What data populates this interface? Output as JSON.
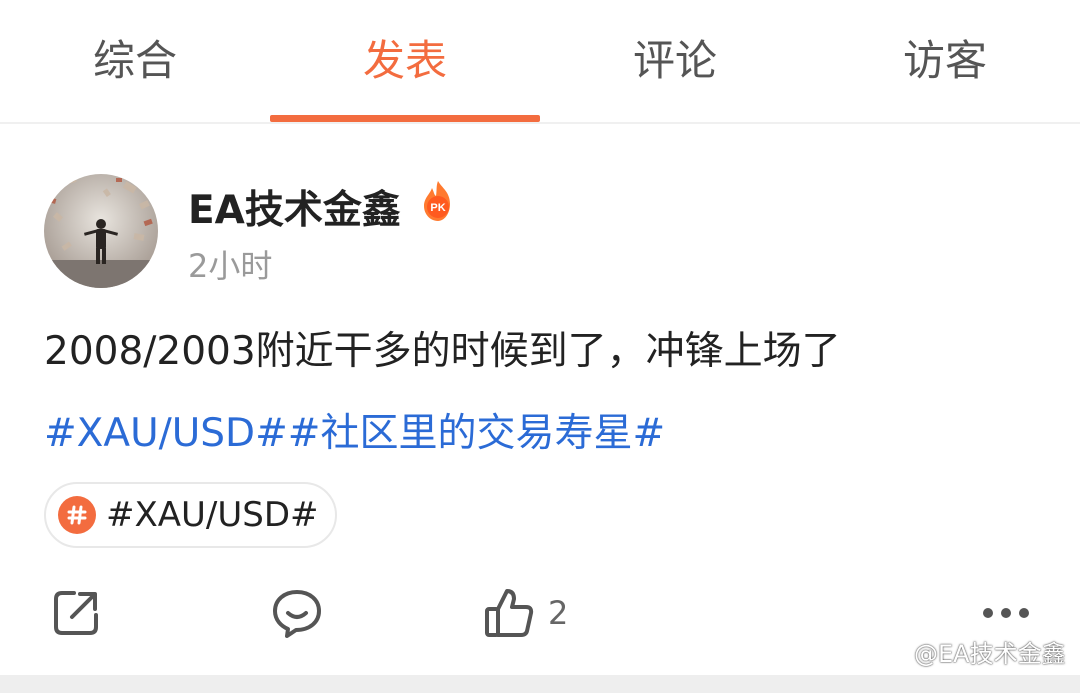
{
  "tabs": [
    {
      "label": "综合"
    },
    {
      "label": "发表"
    },
    {
      "label": "评论"
    },
    {
      "label": "访客"
    }
  ],
  "active_tab_index": 1,
  "post": {
    "username": "EA技术金鑫",
    "badge_text": "PK",
    "time": "2小时",
    "text": "2008/2003附近干多的时候到了，冲锋上场了",
    "tags": "#XAU/USD##社区里的交易寿星#",
    "topic_chip": "#XAU/USD#",
    "like_count": "2"
  },
  "watermark": "@EA技术金鑫",
  "colors": {
    "accent": "#f36c3f",
    "link": "#2b6bd6",
    "muted": "#9a9a9a"
  },
  "icons": [
    "share-icon",
    "comment-icon",
    "like-icon",
    "more-icon",
    "topic-hash-icon",
    "pk-flame-badge-icon"
  ]
}
